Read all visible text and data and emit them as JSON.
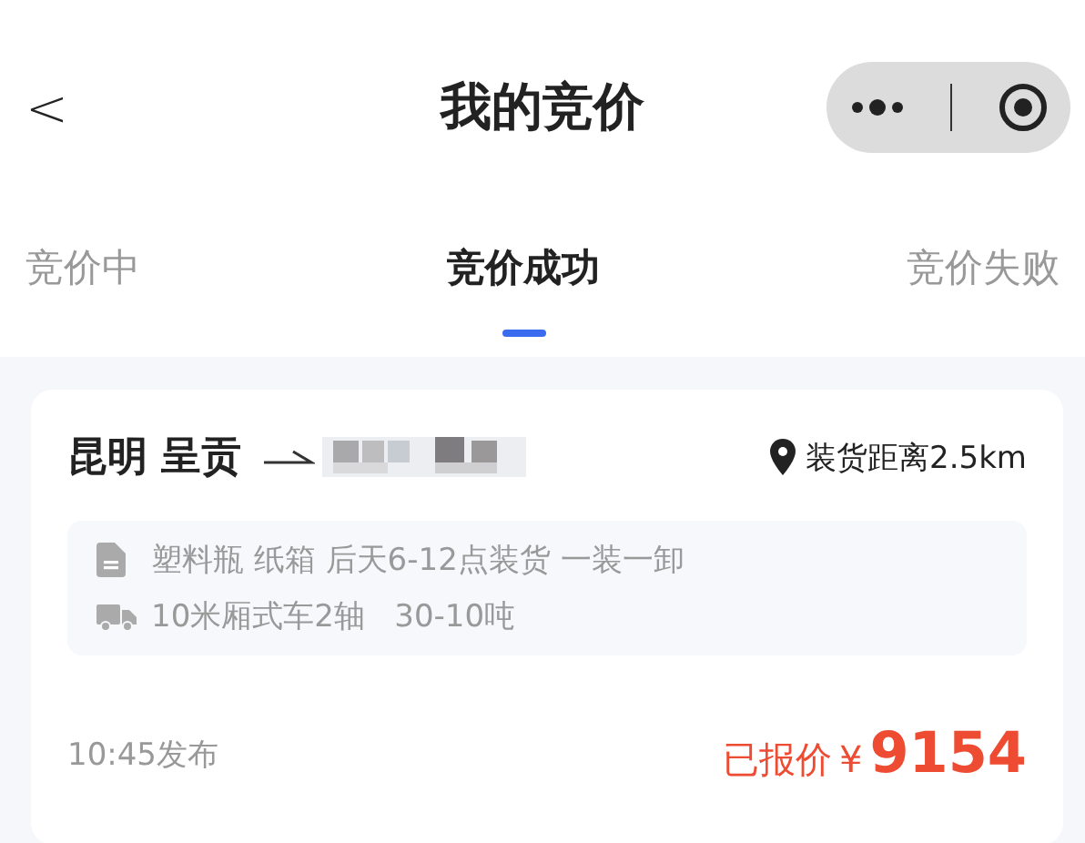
{
  "navbar": {
    "back": "<",
    "title": "我的竞价"
  },
  "tabs": [
    {
      "label": "竞价中",
      "selected": false
    },
    {
      "label": "竞价成功",
      "selected": true
    },
    {
      "label": "竞价失败",
      "selected": false
    }
  ],
  "card": {
    "origin": "昆明 呈贡",
    "distance": "装货距离2.5km",
    "cargo": "塑料瓶 纸箱 后天6-12点装货 一装一卸",
    "vehicle": "10米厢式车2轴   30-10吨",
    "posted": "10:45发布",
    "quote_label": "已报价",
    "currency": "¥",
    "price": "9154"
  }
}
